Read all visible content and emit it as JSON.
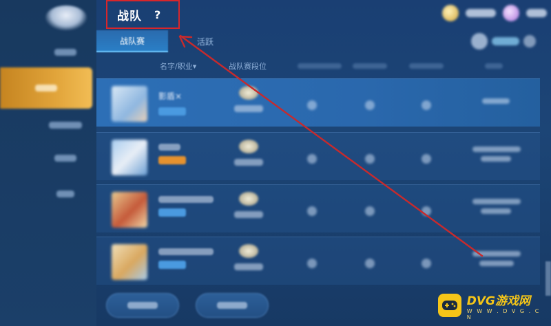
{
  "header": {
    "title": "战队",
    "help_icon": "?"
  },
  "tabs": [
    {
      "label": "战队赛",
      "active": true
    },
    {
      "label": "活跃",
      "active": false
    }
  ],
  "columns": {
    "name": "名字/职业▾",
    "rank": "战队赛段位"
  },
  "rows": [
    {
      "name": "影盾×"
    },
    {
      "name": ""
    },
    {
      "name": ""
    },
    {
      "name": ""
    }
  ],
  "watermark": {
    "main": "DVG游戏网",
    "sub": "W W W . D V G . C N"
  },
  "colors": {
    "accent_orange": "#e1a43a",
    "annotation_red": "#d8262b",
    "watermark_yellow": "#f5c518"
  }
}
